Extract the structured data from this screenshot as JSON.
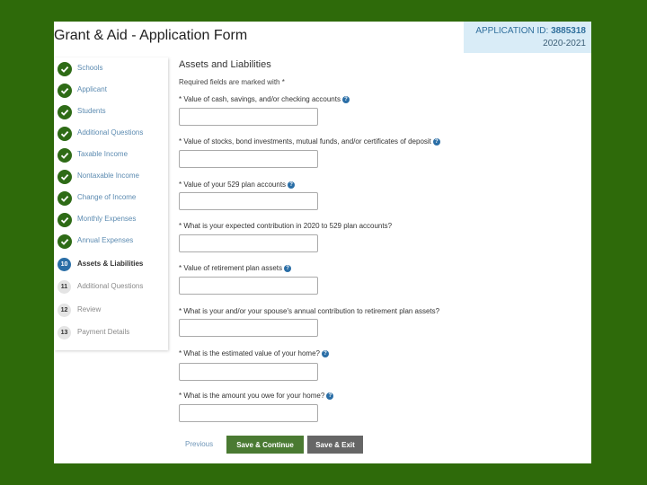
{
  "header": {
    "title": "Grant & Aid - Application Form",
    "app_id_label": "APPLICATION ID:",
    "app_id_value": "3885318",
    "year": "2020-2021"
  },
  "colors": {
    "background_frame": "#2e6a0a",
    "accent_green": "#2e6b16",
    "accent_blue": "#2a6ea6",
    "link_blue": "#5c8bb1"
  },
  "sidebar": {
    "steps": [
      {
        "label": "Schools",
        "status": "complete",
        "icon": "checkmark-icon"
      },
      {
        "label": "Applicant",
        "status": "complete",
        "icon": "checkmark-icon"
      },
      {
        "label": "Students",
        "status": "complete",
        "icon": "checkmark-icon"
      },
      {
        "label": "Additional Questions",
        "status": "complete",
        "icon": "checkmark-icon"
      },
      {
        "label": "Taxable Income",
        "status": "complete",
        "icon": "checkmark-icon"
      },
      {
        "label": "Nontaxable Income",
        "status": "complete",
        "icon": "checkmark-icon"
      },
      {
        "label": "Change of Income",
        "status": "complete",
        "icon": "checkmark-icon"
      },
      {
        "label": "Monthly Expenses",
        "status": "complete",
        "icon": "checkmark-icon"
      },
      {
        "label": "Annual Expenses",
        "status": "complete",
        "icon": "checkmark-icon"
      },
      {
        "label": "Assets & Liabilities",
        "status": "current",
        "number": "10"
      },
      {
        "label": "Additional Questions",
        "status": "todo",
        "number": "11"
      },
      {
        "label": "Review",
        "status": "todo",
        "number": "12"
      },
      {
        "label": "Payment Details",
        "status": "todo",
        "number": "13"
      }
    ]
  },
  "main": {
    "section_title": "Assets and Liabilities",
    "required_note": "Required fields are marked with *",
    "questions": [
      {
        "label": "* Value of cash, savings, and/or checking accounts",
        "help": true,
        "value": ""
      },
      {
        "label": "* Value of stocks, bond investments, mutual funds, and/or certificates of deposit",
        "help": true,
        "value": ""
      },
      {
        "label": "* Value of your 529 plan accounts",
        "help": true,
        "value": ""
      },
      {
        "label": "* What is your expected contribution in 2020 to 529 plan accounts?",
        "help": false,
        "value": ""
      },
      {
        "label": "* Value of retirement plan assets",
        "help": true,
        "value": ""
      },
      {
        "label": "* What is your and/or your spouse's annual contribution to retirement plan assets?",
        "help": false,
        "value": ""
      },
      {
        "label": "* What is the estimated value of your home?",
        "help": true,
        "value": ""
      },
      {
        "label": "* What is the amount you owe for your home?",
        "help": true,
        "value": ""
      }
    ]
  },
  "actions": {
    "previous_label": "Previous",
    "save_continue_label": "Save & Continue",
    "save_exit_label": "Save & Exit"
  }
}
